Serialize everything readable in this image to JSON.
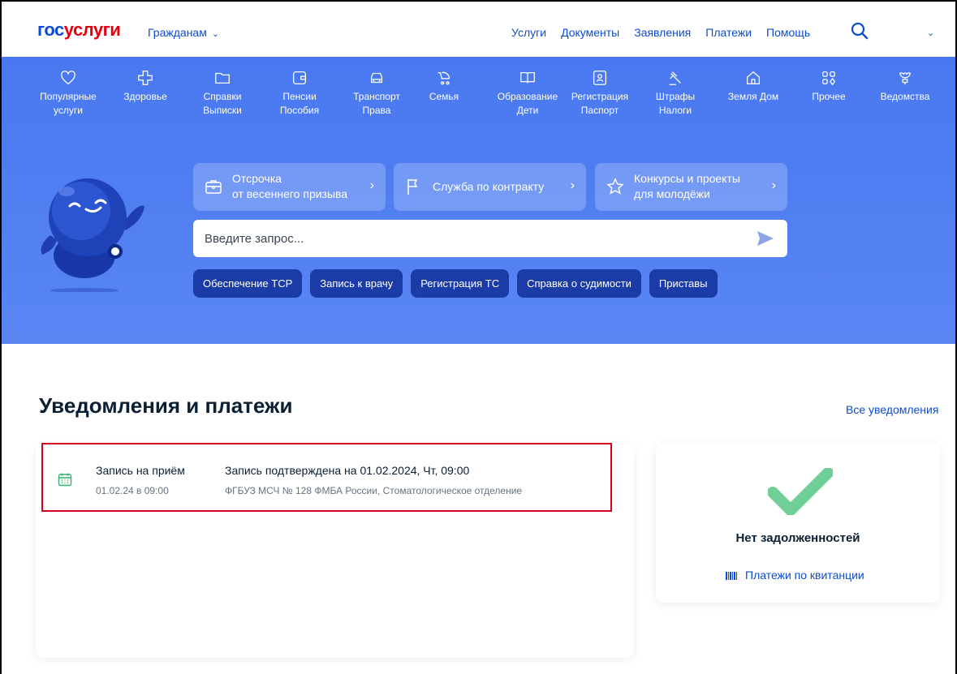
{
  "header": {
    "logo_part1": "гос",
    "logo_part2": "услуги",
    "citizens_label": "Гражданам",
    "nav": [
      "Услуги",
      "Документы",
      "Заявления",
      "Платежи",
      "Помощь"
    ]
  },
  "categories": [
    {
      "line1": "Популярные",
      "line2": "услуги",
      "icon": "heart-icon"
    },
    {
      "line1": "Здоровье",
      "line2": "",
      "icon": "medical-cross-icon"
    },
    {
      "line1": "Справки",
      "line2": "Выписки",
      "icon": "folder-icon"
    },
    {
      "line1": "Пенсии",
      "line2": "Пособия",
      "icon": "wallet-icon"
    },
    {
      "line1": "Транспорт",
      "line2": "Права",
      "icon": "car-icon"
    },
    {
      "line1": "Семья",
      "line2": "",
      "icon": "stroller-icon"
    },
    {
      "line1": "Образование",
      "line2": "Дети",
      "icon": "book-icon"
    },
    {
      "line1": "Регистрация",
      "line2": "Паспорт",
      "icon": "id-card-icon"
    },
    {
      "line1": "Штрафы",
      "line2": "Налоги",
      "icon": "gavel-icon"
    },
    {
      "line1": "Земля Дом",
      "line2": "",
      "icon": "house-icon"
    },
    {
      "line1": "Прочее",
      "line2": "",
      "icon": "grid-icon"
    },
    {
      "line1": "Ведомства",
      "line2": "",
      "icon": "emblem-icon"
    }
  ],
  "quick_links": [
    {
      "line1": "Отсрочка",
      "line2": "от весеннего призыва",
      "icon": "briefcase-icon"
    },
    {
      "line1": "Служба по контракту",
      "line2": "",
      "icon": "flag-icon"
    },
    {
      "line1": "Конкурсы и проекты",
      "line2": "для молодёжи",
      "icon": "star-icon"
    }
  ],
  "search": {
    "placeholder": "Введите запрос..."
  },
  "chips": [
    "Обеспечение ТСР",
    "Запись к врачу",
    "Регистрация ТС",
    "Справка о судимости",
    "Приставы"
  ],
  "notifications": {
    "title": "Уведомления и платежи",
    "all_link": "Все уведомления",
    "item": {
      "title": "Запись на приём",
      "date": "01.02.24 в 09:00",
      "message": "Запись подтверждена на 01.02.2024, Чт, 09:00",
      "organization": "ФГБУЗ МСЧ № 128 ФМБА России, Стоматологическое отделение"
    }
  },
  "debts": {
    "status": "Нет задолженностей",
    "link": "Платежи по квитанции"
  },
  "colors": {
    "brand_blue": "#0d4cd3",
    "brand_red": "#e3000f",
    "hero_blue": "#4f7ef2",
    "chip_blue": "#1b3ba6",
    "check_green": "#6fcf97",
    "highlight_red": "#d6001c"
  }
}
